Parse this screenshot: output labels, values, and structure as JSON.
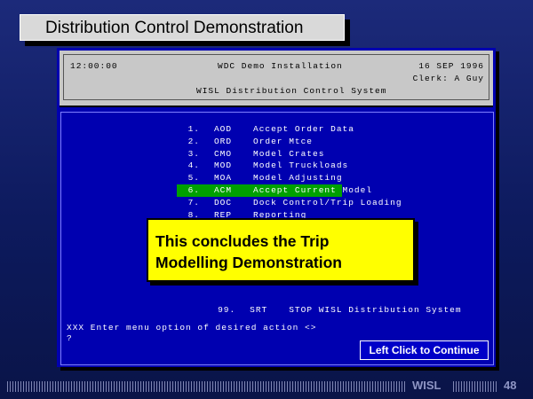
{
  "slide": {
    "title": "Distribution Control Demonstration",
    "footer_label": "WISL",
    "page_number": "48"
  },
  "terminal": {
    "time": "12:00:00",
    "installation": "WDC Demo Installation",
    "date": "16 SEP 1996",
    "clerk": "Clerk: A Guy",
    "system_name": "WISL Distribution Control System",
    "menu": [
      {
        "num": "1.",
        "code": "AOD",
        "desc": "Accept Order Data"
      },
      {
        "num": "2.",
        "code": "ORD",
        "desc": "Order Mtce"
      },
      {
        "num": "3.",
        "code": "CMO",
        "desc": "Model Crates"
      },
      {
        "num": "4.",
        "code": "MOD",
        "desc": "Model Truckloads"
      },
      {
        "num": "5.",
        "code": "MOA",
        "desc": "Model Adjusting"
      },
      {
        "num": "6.",
        "code": "ACM",
        "desc": "Accept Current Model"
      },
      {
        "num": "7.",
        "code": "DOC",
        "desc": "Dock Control/Trip Loading"
      },
      {
        "num": "8.",
        "code": "REP",
        "desc": "Reporting"
      }
    ],
    "highlighted_index": 5,
    "stop_option": {
      "num": "99.",
      "code": "SRT",
      "desc": "STOP WISL Distribution System"
    },
    "prompt": "XXX Enter menu option of desired action <>",
    "cursor": "?"
  },
  "popup": {
    "line1": "This concludes the Trip",
    "line2": "Modelling Demonstration"
  },
  "continue_button": {
    "label": "Left Click to Continue"
  },
  "colors": {
    "highlight": "#00a000",
    "popup_bg": "#ffff00",
    "screen_bg": "#0000b0"
  }
}
